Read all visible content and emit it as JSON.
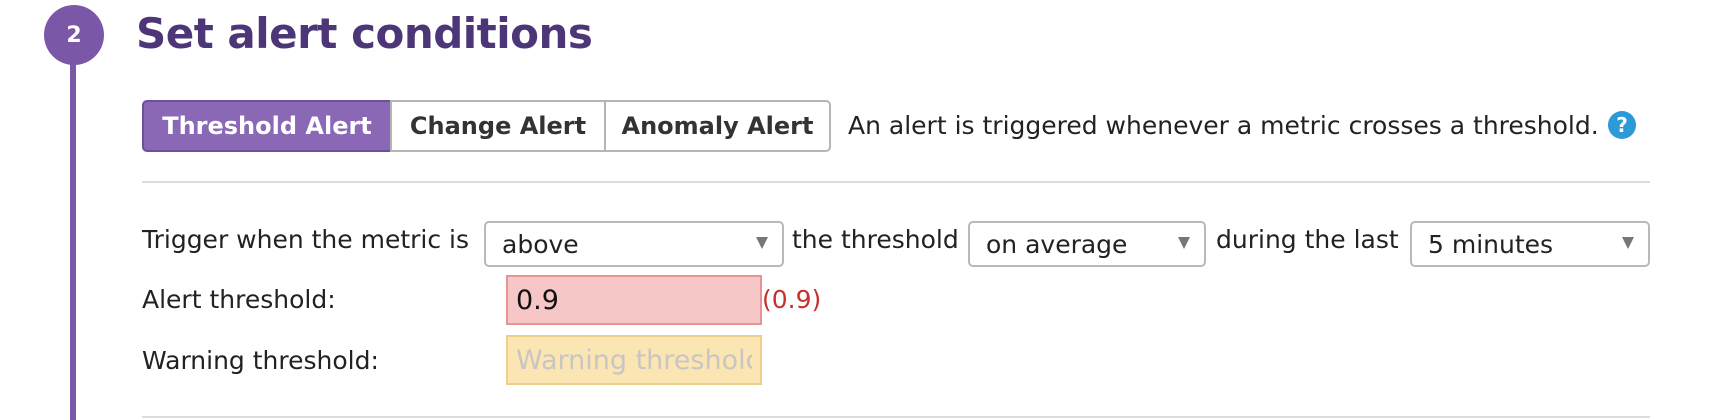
{
  "step": {
    "number": "2",
    "title": "Set alert conditions"
  },
  "alert_types": {
    "tabs": [
      {
        "label": "Threshold Alert",
        "selected": true
      },
      {
        "label": "Change Alert",
        "selected": false
      },
      {
        "label": "Anomaly Alert",
        "selected": false
      }
    ],
    "description": "An alert is triggered whenever a metric crosses a threshold.",
    "help_icon": "question-mark-icon"
  },
  "trigger": {
    "prefix": "Trigger when the metric is",
    "comparison": "above",
    "middle": "the threshold",
    "aggregation": "on average",
    "during": "during the last",
    "window": "5 minutes"
  },
  "thresholds": {
    "alert_label": "Alert threshold:",
    "alert_value": "0.9",
    "alert_echo": "(0.9)",
    "warning_label": "Warning threshold:",
    "warning_value": "",
    "warning_placeholder": "Warning threshold"
  },
  "colors": {
    "accent": "#7b57a7",
    "title": "#4d3677",
    "alert_field": "#f6c7c6",
    "warning_field": "#fbe6b3",
    "error_text": "#c9302c",
    "help": "#2b9ad7"
  }
}
